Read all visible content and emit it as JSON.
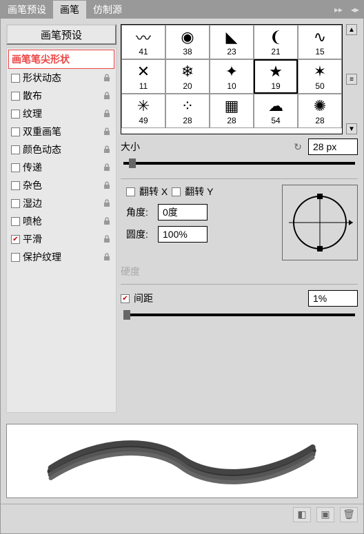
{
  "header": {
    "tabs": [
      "画笔预设",
      "画笔",
      "仿制源"
    ],
    "active_index": 1
  },
  "left": {
    "preset_button": "画笔预设",
    "tip_shape_label": "画笔笔尖形状",
    "options": [
      {
        "label": "形状动态",
        "checked": false,
        "locked": true
      },
      {
        "label": "散布",
        "checked": false,
        "locked": true
      },
      {
        "label": "纹理",
        "checked": false,
        "locked": true
      },
      {
        "label": "双重画笔",
        "checked": false,
        "locked": true
      },
      {
        "label": "颜色动态",
        "checked": false,
        "locked": true
      },
      {
        "label": "传递",
        "checked": false,
        "locked": true
      },
      {
        "label": "杂色",
        "checked": false,
        "locked": true
      },
      {
        "label": "湿边",
        "checked": false,
        "locked": true
      },
      {
        "label": "喷枪",
        "checked": false,
        "locked": true
      },
      {
        "label": "平滑",
        "checked": true,
        "locked": true
      },
      {
        "label": "保护纹理",
        "checked": false,
        "locked": true
      }
    ]
  },
  "brushes": [
    {
      "n": "41",
      "g": "brush-z"
    },
    {
      "n": "38",
      "g": "brush-blob"
    },
    {
      "n": "23",
      "g": "brush-tri"
    },
    {
      "n": "21",
      "g": "brush-curve"
    },
    {
      "n": "15",
      "g": "brush-swirl"
    },
    {
      "n": "11",
      "g": "brush-x"
    },
    {
      "n": "20",
      "g": "brush-snow"
    },
    {
      "n": "10",
      "g": "brush-star-o"
    },
    {
      "n": "19",
      "g": "brush-star-f",
      "sel": true
    },
    {
      "n": "50",
      "g": "brush-spark"
    },
    {
      "n": "49",
      "g": "brush-burst"
    },
    {
      "n": "28",
      "g": "brush-dots"
    },
    {
      "n": "28",
      "g": "brush-grid"
    },
    {
      "n": "54",
      "g": "brush-cloud"
    },
    {
      "n": "28",
      "g": "brush-splat"
    }
  ],
  "size": {
    "label": "大小",
    "value": "28 px"
  },
  "flip": {
    "x_label": "翻转 X",
    "y_label": "翻转 Y",
    "x": false,
    "y": false
  },
  "angle": {
    "label": "角度:",
    "value": "0度"
  },
  "roundness": {
    "label": "圆度:",
    "value": "100%"
  },
  "hardness": {
    "label": "硬度"
  },
  "spacing": {
    "label": "间距",
    "checked": true,
    "value": "1%"
  },
  "icons": {
    "reset": "↻",
    "up": "▲",
    "down": "▼",
    "menu": "≡",
    "collapse": "▸▸",
    "close": "◂▸"
  }
}
